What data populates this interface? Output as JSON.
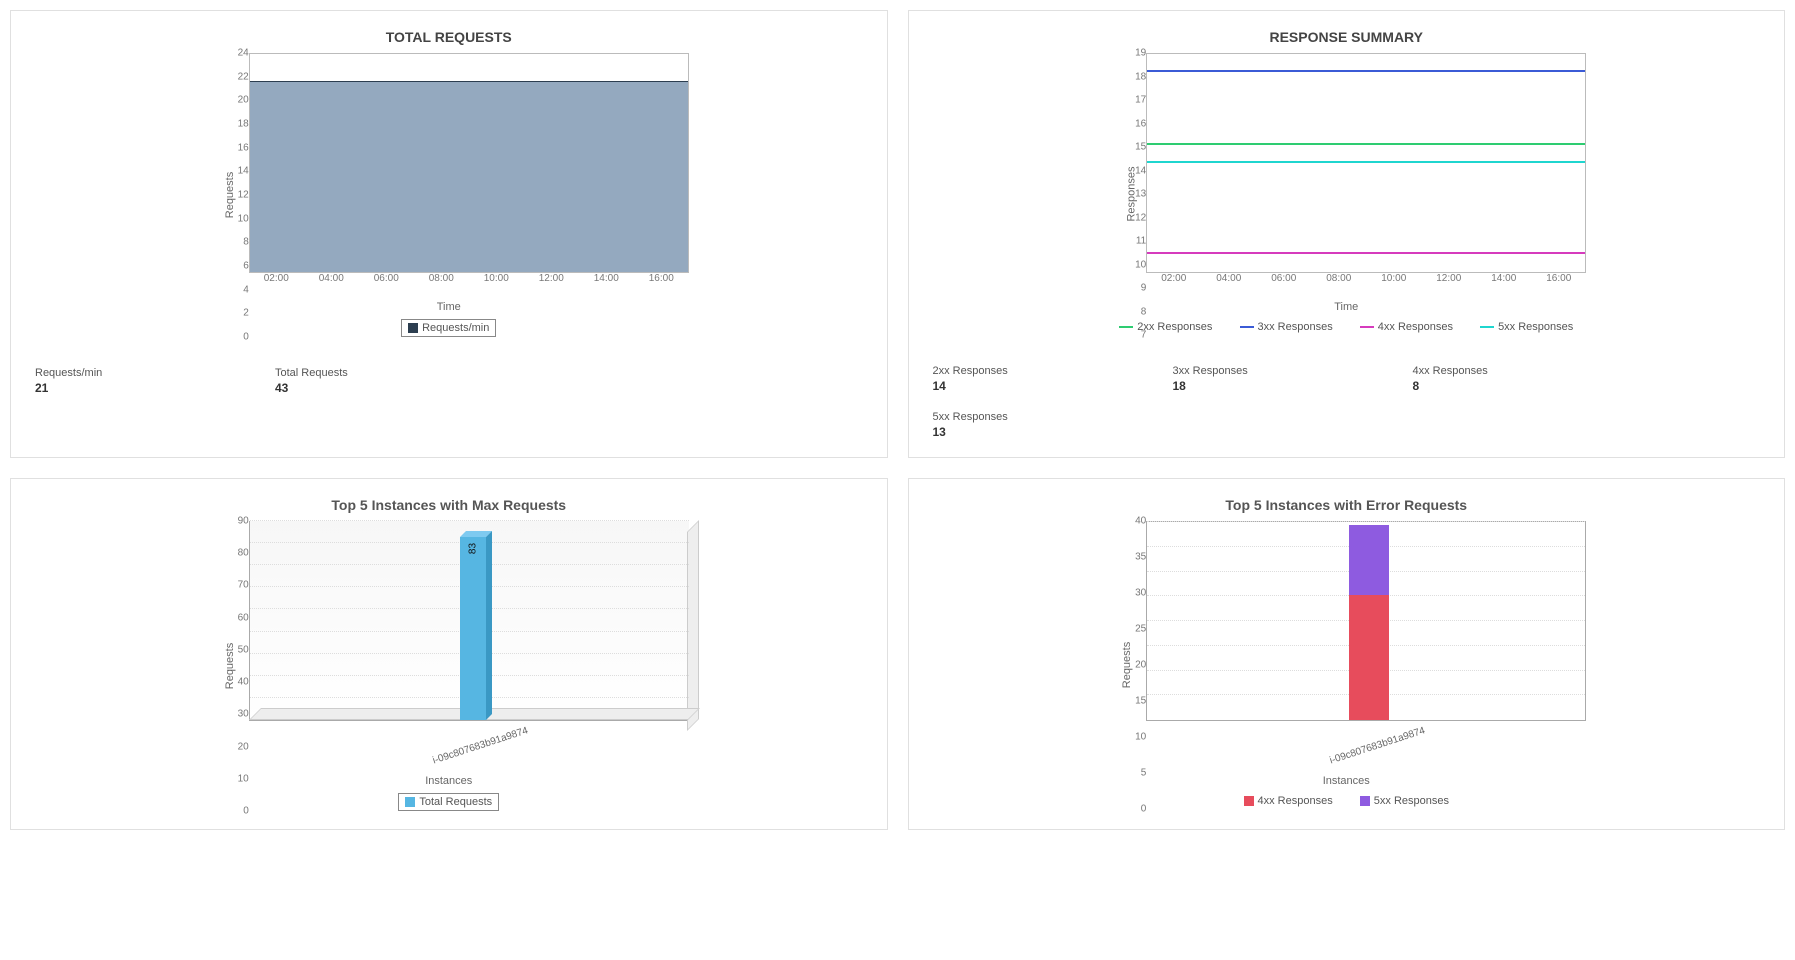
{
  "chart_data": [
    {
      "id": "total_requests",
      "type": "area",
      "title": "TOTAL REQUESTS",
      "xlabel": "Time",
      "ylabel": "Requests",
      "ylim": [
        0,
        24
      ],
      "yticks": [
        0,
        2,
        4,
        6,
        8,
        10,
        12,
        14,
        16,
        18,
        20,
        22,
        24
      ],
      "categories": [
        "02:00",
        "04:00",
        "06:00",
        "08:00",
        "10:00",
        "12:00",
        "14:00",
        "16:00"
      ],
      "series": [
        {
          "name": "Requests/min",
          "color": "#2c3e50",
          "fill": "#94a9bf",
          "values": [
            21,
            21,
            21,
            21,
            21,
            21,
            21,
            21
          ]
        }
      ],
      "legend": [
        "Requests/min"
      ]
    },
    {
      "id": "response_summary",
      "type": "line",
      "title": "RESPONSE SUMMARY",
      "xlabel": "Time",
      "ylabel": "Responses",
      "ylim": [
        7,
        19
      ],
      "yticks": [
        7,
        8,
        9,
        10,
        11,
        12,
        13,
        14,
        15,
        16,
        17,
        18,
        19
      ],
      "categories": [
        "02:00",
        "04:00",
        "06:00",
        "08:00",
        "10:00",
        "12:00",
        "14:00",
        "16:00"
      ],
      "series": [
        {
          "name": "2xx Responses",
          "color": "#2ecc71",
          "values": [
            14,
            14,
            14,
            14,
            14,
            14,
            14,
            14
          ]
        },
        {
          "name": "3xx Responses",
          "color": "#3b5bd6",
          "values": [
            18,
            18,
            18,
            18,
            18,
            18,
            18,
            18
          ]
        },
        {
          "name": "4xx Responses",
          "color": "#d63bbd",
          "values": [
            8,
            8,
            8,
            8,
            8,
            8,
            8,
            8
          ]
        },
        {
          "name": "5xx Responses",
          "color": "#1fd6cf",
          "values": [
            13,
            13,
            13,
            13,
            13,
            13,
            13,
            13
          ]
        }
      ]
    },
    {
      "id": "top5_max",
      "type": "bar",
      "title": "Top 5 Instances with Max Requests",
      "xlabel": "Instances",
      "ylabel": "Requests",
      "ylim": [
        0,
        90
      ],
      "yticks": [
        0,
        10,
        20,
        30,
        40,
        50,
        60,
        70,
        80,
        90
      ],
      "categories": [
        "i-09c807683b91a9874"
      ],
      "series": [
        {
          "name": "Total Requests",
          "color": "#56b6e2",
          "values": [
            83
          ]
        }
      ]
    },
    {
      "id": "top5_error",
      "type": "bar",
      "stacked": true,
      "title": "Top 5 Instances with Error Requests",
      "xlabel": "Instances",
      "ylabel": "Requests",
      "ylim": [
        0,
        40
      ],
      "yticks": [
        0,
        5,
        10,
        15,
        20,
        25,
        30,
        35,
        40
      ],
      "categories": [
        "i-09c807683b91a9874"
      ],
      "series": [
        {
          "name": "4xx Responses",
          "color": "#e74c5c",
          "values": [
            25
          ]
        },
        {
          "name": "5xx Responses",
          "color": "#8e5be0",
          "values": [
            14
          ]
        }
      ]
    }
  ],
  "panels": {
    "total_requests": {
      "title": "TOTAL REQUESTS",
      "legend0": "Requests/min",
      "xlabel": "Time",
      "ylabel": "Requests",
      "stats": [
        {
          "label": "Requests/min",
          "value": "21"
        },
        {
          "label": "Total Requests",
          "value": "43"
        }
      ]
    },
    "response_summary": {
      "title": "RESPONSE SUMMARY",
      "xlabel": "Time",
      "ylabel": "Responses",
      "legend": [
        "2xx Responses",
        "3xx Responses",
        "4xx Responses",
        "5xx Responses"
      ],
      "stats": [
        {
          "label": "2xx Responses",
          "value": "14"
        },
        {
          "label": "3xx Responses",
          "value": "18"
        },
        {
          "label": "4xx Responses",
          "value": "8"
        },
        {
          "label": "5xx Responses",
          "value": "13"
        }
      ]
    },
    "top5_max": {
      "title": "Top 5 Instances with Max Requests",
      "xlabel": "Instances",
      "ylabel": "Requests",
      "legend0": "Total Requests",
      "bar_label": "83",
      "category0": "i-09c807683b91a9874"
    },
    "top5_error": {
      "title": "Top 5 Instances with Error Requests",
      "xlabel": "Instances",
      "ylabel": "Requests",
      "legend": [
        "4xx Responses",
        "5xx Responses"
      ],
      "category0": "i-09c807683b91a9874"
    }
  },
  "ticks": {
    "time": [
      "02:00",
      "04:00",
      "06:00",
      "08:00",
      "10:00",
      "12:00",
      "14:00",
      "16:00"
    ],
    "y_total": [
      "0",
      "2",
      "4",
      "6",
      "8",
      "10",
      "12",
      "14",
      "16",
      "18",
      "20",
      "22",
      "24"
    ],
    "y_resp": [
      "7",
      "8",
      "9",
      "10",
      "11",
      "12",
      "13",
      "14",
      "15",
      "16",
      "17",
      "18",
      "19"
    ],
    "y_max": [
      "0",
      "10",
      "20",
      "30",
      "40",
      "50",
      "60",
      "70",
      "80",
      "90"
    ],
    "y_err": [
      "0",
      "5",
      "10",
      "15",
      "20",
      "25",
      "30",
      "35",
      "40"
    ]
  }
}
